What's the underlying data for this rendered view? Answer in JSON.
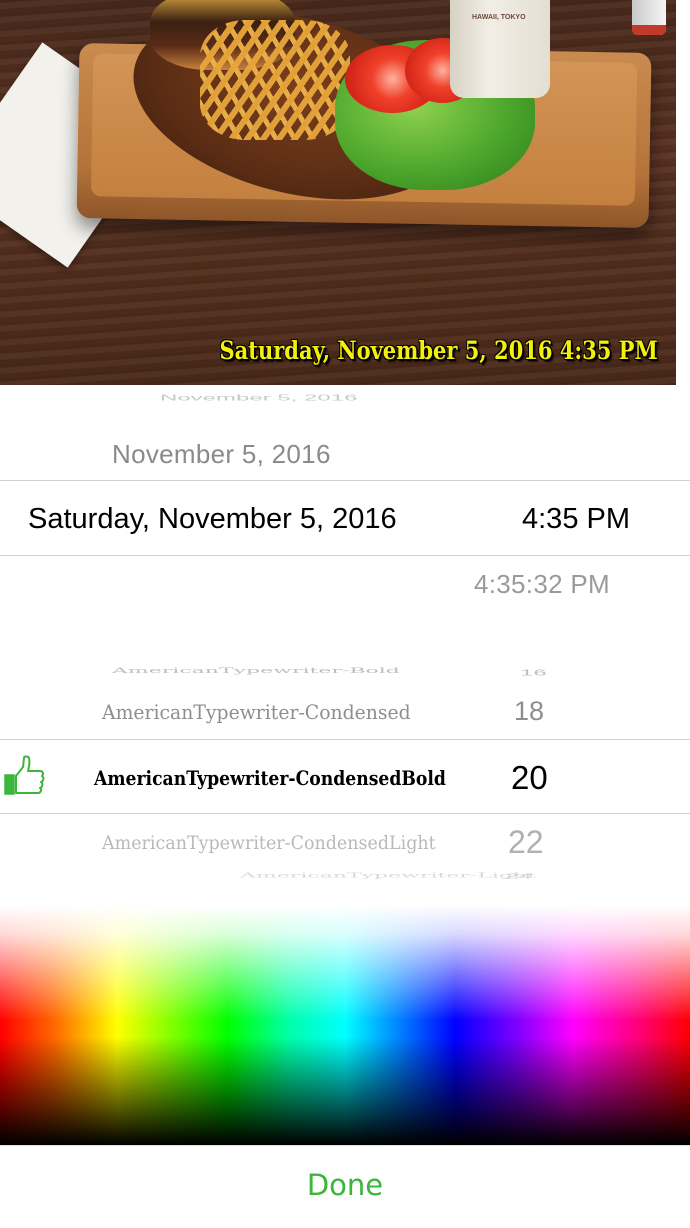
{
  "photo": {
    "caption": "Saturday, November 5, 2016 4:35 PM",
    "cup_text": "HAWAII, TOKYO",
    "caption_color": "#f2f00c"
  },
  "date_picker": {
    "prev_date_faded": "November 5, 2016",
    "prev_date": "November 5, 2016",
    "selected_date": "Saturday, November 5, 2016",
    "selected_time": "4:35 PM",
    "next_time": "4:35:32 PM"
  },
  "font_picker": {
    "prev_font_faded": "AmericanTypewriter-Bold",
    "prev_size_faded": "16",
    "prev_font": "AmericanTypewriter-Condensed",
    "prev_size": "18",
    "selected_font": "AmericanTypewriter-CondensedBold",
    "selected_size": "20",
    "next_font": "AmericanTypewriter-CondensedLight",
    "next_size": "22",
    "next_font_faded": "AmericanTypewriter-Light",
    "next_size_faded": "24",
    "icon": "thumbs-up-icon",
    "icon_color": "#3bb53b"
  },
  "color_picker": {
    "type": "hue-spectrum"
  },
  "done_bar": {
    "done_label": "Done",
    "accent": "#3bb53b"
  }
}
